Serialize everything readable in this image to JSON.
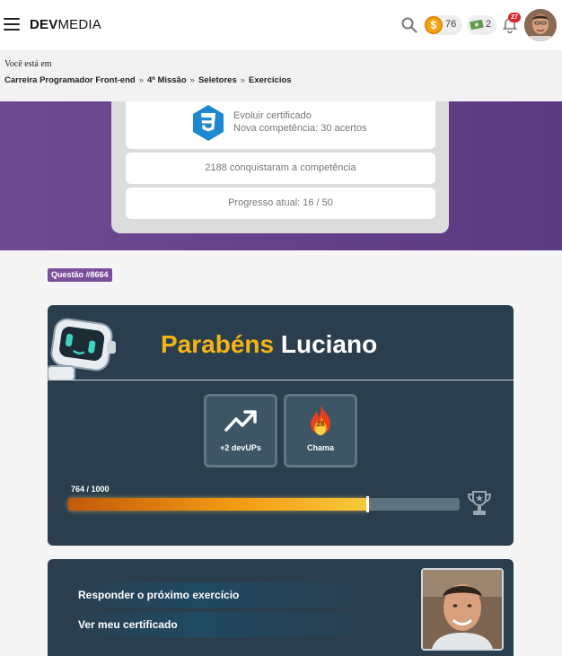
{
  "header": {
    "logo_bold": "DEV",
    "logo_light": "MEDIA",
    "coins": "76",
    "cash": "2",
    "notifications": "27"
  },
  "breadcrumb": {
    "lead": "Você está em",
    "items": [
      "Carreira Programador Front-end",
      "4ª Missão",
      "Seletores",
      "Exercícios"
    ],
    "separator": "»"
  },
  "competence": {
    "line1": "Evoluir certificado",
    "line2": "Nova competência: 30 acertos",
    "conquered": "2188 conquistaram a competência",
    "progress": "Progresso atual: 16 / 50",
    "badge": "3"
  },
  "question": {
    "tag": "Questão #8664"
  },
  "congrats": {
    "word": "Parabéns",
    "name": "Luciano",
    "devups_label": "+2 devUPs",
    "flame_label": "Chama",
    "flame_count": "18",
    "xp_label": "764 / 1000",
    "xp_current": 764,
    "xp_total": 1000
  },
  "actions": {
    "next": "Responder o próximo exercício",
    "certificate": "Ver meu certificado"
  },
  "colors": {
    "purple": "#6d4a91",
    "panel": "#2b3e4d",
    "accent_yellow": "#f5b415",
    "css_blue": "#1e88d0"
  }
}
